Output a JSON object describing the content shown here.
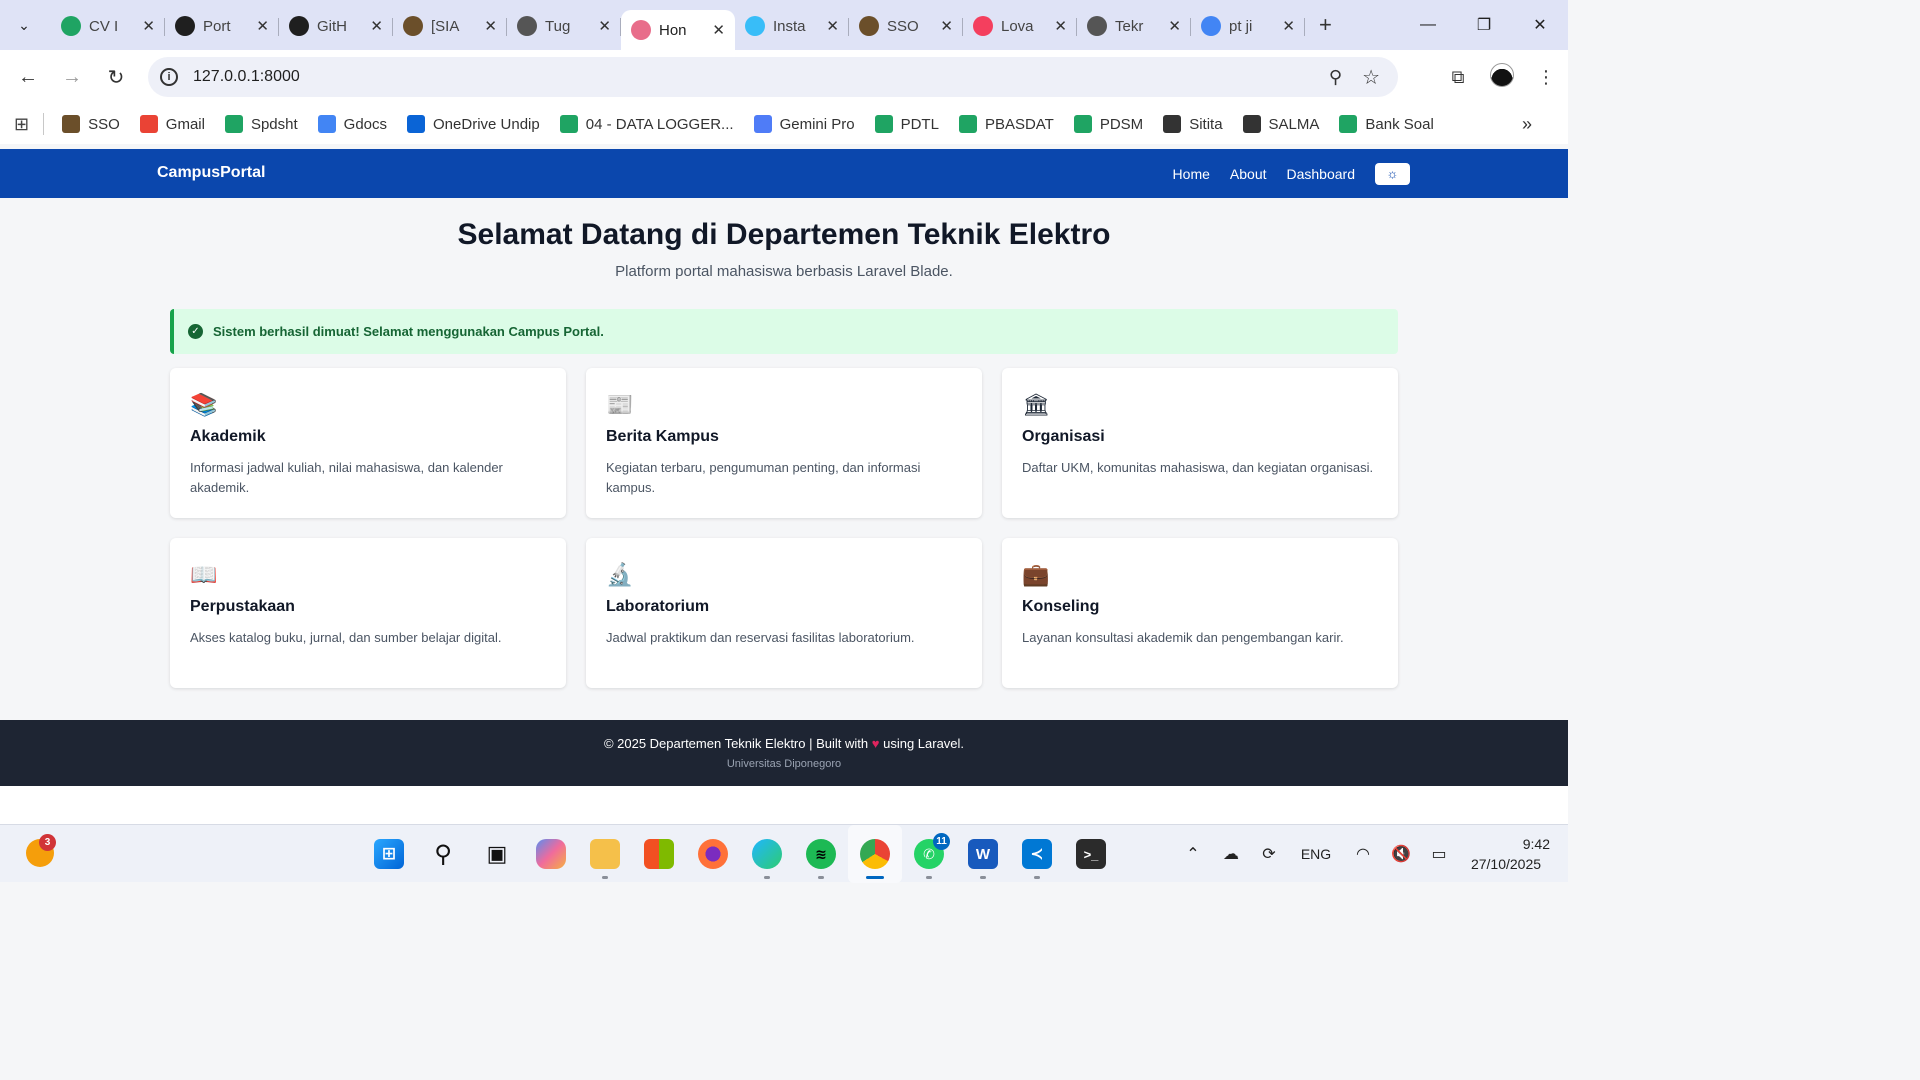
{
  "browser": {
    "tabs": [
      {
        "label": "CV I",
        "icon": "drive-icon",
        "color": "#1fa463"
      },
      {
        "label": "Port",
        "icon": "github-icon",
        "color": "#1f1f1f"
      },
      {
        "label": "GitH",
        "icon": "github-icon",
        "color": "#1f1f1f"
      },
      {
        "label": "[SIA",
        "icon": "undip-icon",
        "color": "#6b4f2a"
      },
      {
        "label": "Tug",
        "icon": "globe-icon",
        "color": "#555555"
      },
      {
        "label": "Hon",
        "icon": "laravel-icon",
        "color": "#e86d8a",
        "active": true
      },
      {
        "label": "Insta",
        "icon": "tailwind-icon",
        "color": "#38bdf8"
      },
      {
        "label": "SSO",
        "icon": "undip-icon",
        "color": "#6b4f2a"
      },
      {
        "label": "Lova",
        "icon": "lovable-icon",
        "color": "#f43f5e"
      },
      {
        "label": "Tekr",
        "icon": "globe-icon",
        "color": "#555555"
      },
      {
        "label": "pt ji",
        "icon": "google-icon",
        "color": "#4285f4"
      }
    ],
    "address": "127.0.0.1:8000",
    "bookmarks": [
      {
        "label": "SSO",
        "icon": "undip-icon",
        "color": "#6b4f2a"
      },
      {
        "label": "Gmail",
        "icon": "gmail-icon",
        "color": "#ea4335"
      },
      {
        "label": "Spdsht",
        "icon": "sheets-icon",
        "color": "#1fa463"
      },
      {
        "label": "Gdocs",
        "icon": "docs-icon",
        "color": "#4285f4"
      },
      {
        "label": "OneDrive Undip",
        "icon": "onedrive-icon",
        "color": "#0a64d6"
      },
      {
        "label": "04 - DATA LOGGER...",
        "icon": "drive-icon",
        "color": "#1fa463"
      },
      {
        "label": "Gemini Pro",
        "icon": "gemini-icon",
        "color": "#4f7cf7"
      },
      {
        "label": "PDTL",
        "icon": "drive-icon",
        "color": "#1fa463"
      },
      {
        "label": "PBASDAT",
        "icon": "drive-icon",
        "color": "#1fa463"
      },
      {
        "label": "PDSM",
        "icon": "drive-icon",
        "color": "#1fa463"
      },
      {
        "label": "Sitita",
        "icon": "globe-icon",
        "color": "#333333"
      },
      {
        "label": "SALMA",
        "icon": "pen-icon",
        "color": "#333333"
      },
      {
        "label": "Bank Soal",
        "icon": "drive-icon",
        "color": "#1fa463"
      }
    ]
  },
  "site": {
    "brand": "CampusPortal",
    "nav": [
      "Home",
      "About",
      "Dashboard"
    ],
    "hero_title": "Selamat Datang di Departemen Teknik Elektro",
    "hero_sub": "Platform portal mahasiswa berbasis Laravel Blade.",
    "alert": "Sistem berhasil dimuat! Selamat menggunakan Campus Portal.",
    "cards": [
      {
        "title": "Akademik",
        "desc": "Informasi jadwal kuliah, nilai mahasiswa, dan kalender akademik.",
        "icon": "books-icon",
        "glyph": "📚"
      },
      {
        "title": "Berita Kampus",
        "desc": "Kegiatan terbaru, pengumuman penting, dan informasi kampus.",
        "icon": "newspaper-icon",
        "glyph": "📰"
      },
      {
        "title": "Organisasi",
        "desc": "Daftar UKM, komunitas mahasiswa, dan kegiatan organisasi.",
        "icon": "classical-building-icon",
        "glyph": "🏛"
      },
      {
        "title": "Perpustakaan",
        "desc": "Akses katalog buku, jurnal, dan sumber belajar digital.",
        "icon": "open-book-icon",
        "glyph": "📖"
      },
      {
        "title": "Laboratorium",
        "desc": "Jadwal praktikum dan reservasi fasilitas laboratorium.",
        "icon": "microscope-icon",
        "glyph": "🔬"
      },
      {
        "title": "Konseling",
        "desc": "Layanan konsultasi akademik dan pengembangan karir.",
        "icon": "briefcase-icon",
        "glyph": "💼"
      }
    ],
    "footer_line1_a": "© 2025 Departemen Teknik Elektro | Built with",
    "footer_line1_b": "using Laravel.",
    "footer_line2": "Universitas Diponegoro"
  },
  "taskbar": {
    "weather_badge": "3",
    "whatsapp_badge": "11",
    "language": "ENG",
    "time": "9:42",
    "date": "27/10/2025"
  }
}
